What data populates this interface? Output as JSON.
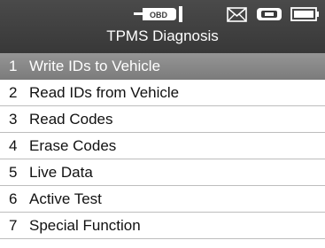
{
  "status_bar": {
    "obd_label": "OBD",
    "icons": [
      "obd-connector-icon",
      "mail-icon",
      "vci-connection-icon",
      "battery-icon"
    ]
  },
  "header": {
    "title": "TPMS Diagnosis"
  },
  "menu": {
    "selected_index": 0,
    "items": [
      {
        "number": "1",
        "label": "Write IDs to Vehicle"
      },
      {
        "number": "2",
        "label": "Read IDs from Vehicle"
      },
      {
        "number": "3",
        "label": "Read Codes"
      },
      {
        "number": "4",
        "label": "Erase Codes"
      },
      {
        "number": "5",
        "label": "Live Data"
      },
      {
        "number": "6",
        "label": "Active Test"
      },
      {
        "number": "7",
        "label": "Special Function"
      }
    ]
  },
  "colors": {
    "header_bg": "#3f3f3f",
    "selected_bg": "#8a8a8a",
    "divider": "#bdbdbd"
  }
}
